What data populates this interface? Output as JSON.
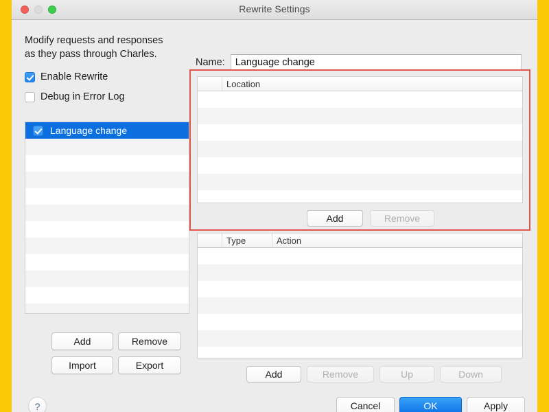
{
  "window": {
    "title": "Rewrite Settings",
    "traffic_lights": [
      "close-button",
      "minimize-button",
      "zoom-button"
    ]
  },
  "left_pane": {
    "description_line1": "Modify requests and responses",
    "description_line2": "as they pass through Charles.",
    "checkboxes": [
      {
        "label": "Enable Rewrite",
        "checked": true
      },
      {
        "label": "Debug in Error Log",
        "checked": false
      }
    ],
    "rules": [
      {
        "label": "Language change",
        "checked": true,
        "selected": true
      }
    ],
    "empty_row_count": 11,
    "buttons": [
      {
        "id": "btn-left-add",
        "label": "Add",
        "enabled": true
      },
      {
        "id": "btn-left-remove",
        "label": "Remove",
        "enabled": true
      },
      {
        "id": "btn-left-import",
        "label": "Import",
        "enabled": true
      },
      {
        "id": "btn-left-export",
        "label": "Export",
        "enabled": true
      }
    ]
  },
  "right_pane": {
    "name_label": "Name:",
    "name_value": "Language change",
    "name_placeholder": "",
    "location_table": {
      "columns": [
        "",
        "Location"
      ],
      "rows": [],
      "empty_row_count": 7,
      "buttons": [
        {
          "id": "btn-loc-add",
          "label": "Add",
          "enabled": true
        },
        {
          "id": "btn-loc-remove",
          "label": "Remove",
          "enabled": false
        }
      ]
    },
    "rules_table": {
      "columns": [
        "",
        "Type",
        "Action"
      ],
      "rows": [],
      "empty_row_count": 7,
      "buttons": [
        {
          "id": "btn-rule-add",
          "label": "Add",
          "enabled": true
        },
        {
          "id": "btn-rule-remove",
          "label": "Remove",
          "enabled": false
        },
        {
          "id": "btn-rule-up",
          "label": "Up",
          "enabled": false
        },
        {
          "id": "btn-rule-down",
          "label": "Down",
          "enabled": false
        }
      ]
    }
  },
  "footer": {
    "help_glyph": "?",
    "buttons": [
      {
        "id": "btn-cancel",
        "label": "Cancel",
        "default": false
      },
      {
        "id": "btn-ok",
        "label": "OK",
        "default": true
      },
      {
        "id": "btn-apply",
        "label": "Apply",
        "default": false
      }
    ]
  },
  "annotation": {
    "type": "highlight-rectangle",
    "color": "#e0564a"
  },
  "colors": {
    "accent_blue": "#0b6fe0",
    "checkbox_blue": "#1f86f0",
    "annotation_red": "#e0564a",
    "page_margin_yellow": "#fbc908",
    "window_background": "#ececec"
  }
}
